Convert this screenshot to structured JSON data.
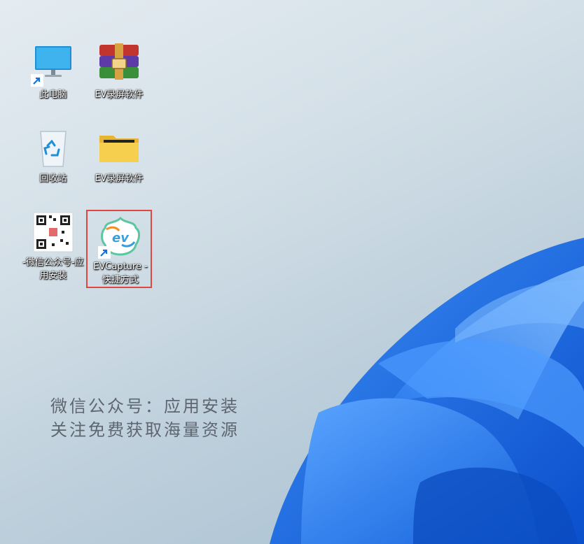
{
  "desktop": {
    "icons": [
      {
        "label": "此电脑",
        "icon": "this-pc-icon"
      },
      {
        "label": "EV录屏软件",
        "icon": "winrar-archive-icon"
      },
      {
        "label": "回收站",
        "icon": "recycle-bin-icon"
      },
      {
        "label": "EV录屏软件",
        "icon": "folder-icon"
      },
      {
        "label": "-微信公众号-应用安装",
        "icon": "qr-code-icon"
      },
      {
        "label": "EVCapture - 快捷方式",
        "icon": "evcapture-logo-icon"
      }
    ],
    "selected_icon_label": "EVCapture - 快捷方式",
    "selection_color": "#e0473f"
  },
  "promo": {
    "line1": "微信公众号：应用安装",
    "line2": "关注免费获取海量资源"
  },
  "colors": {
    "wallpaper_bloom": "#1a6fe6",
    "promo_text": "#5e6670"
  }
}
